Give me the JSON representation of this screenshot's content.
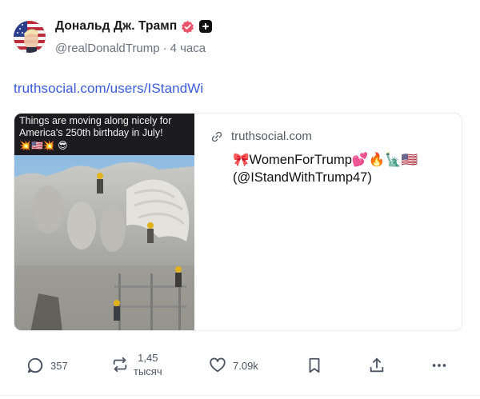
{
  "author": {
    "display_name": "Дональд Дж. Трамп",
    "handle": "@realDonaldTrump",
    "separator": "·",
    "time": "4 часа",
    "badges": [
      "verified-icon",
      "plus-icon"
    ]
  },
  "post": {
    "link_text": "truthsocial.com/users/IStandWi"
  },
  "card": {
    "image_caption": "Things are moving along nicely for America's 250th birthday in July!",
    "image_caption_emoji": "💥🇺🇸💥 😎",
    "domain": "truthsocial.com",
    "title_line1": "🎀WomenForTrump💕🔥🗽🇺🇸",
    "title_line2": "(@IStandWithTrump47)"
  },
  "actions": {
    "reply_count": "357",
    "retruth_count_line1": "1,45",
    "retruth_count_line2": "тысяч",
    "like_count": "7.09k"
  },
  "colors": {
    "link": "#3b5bdb",
    "muted": "#6b7280",
    "verified": "#e8526b",
    "text": "#0f1419"
  }
}
